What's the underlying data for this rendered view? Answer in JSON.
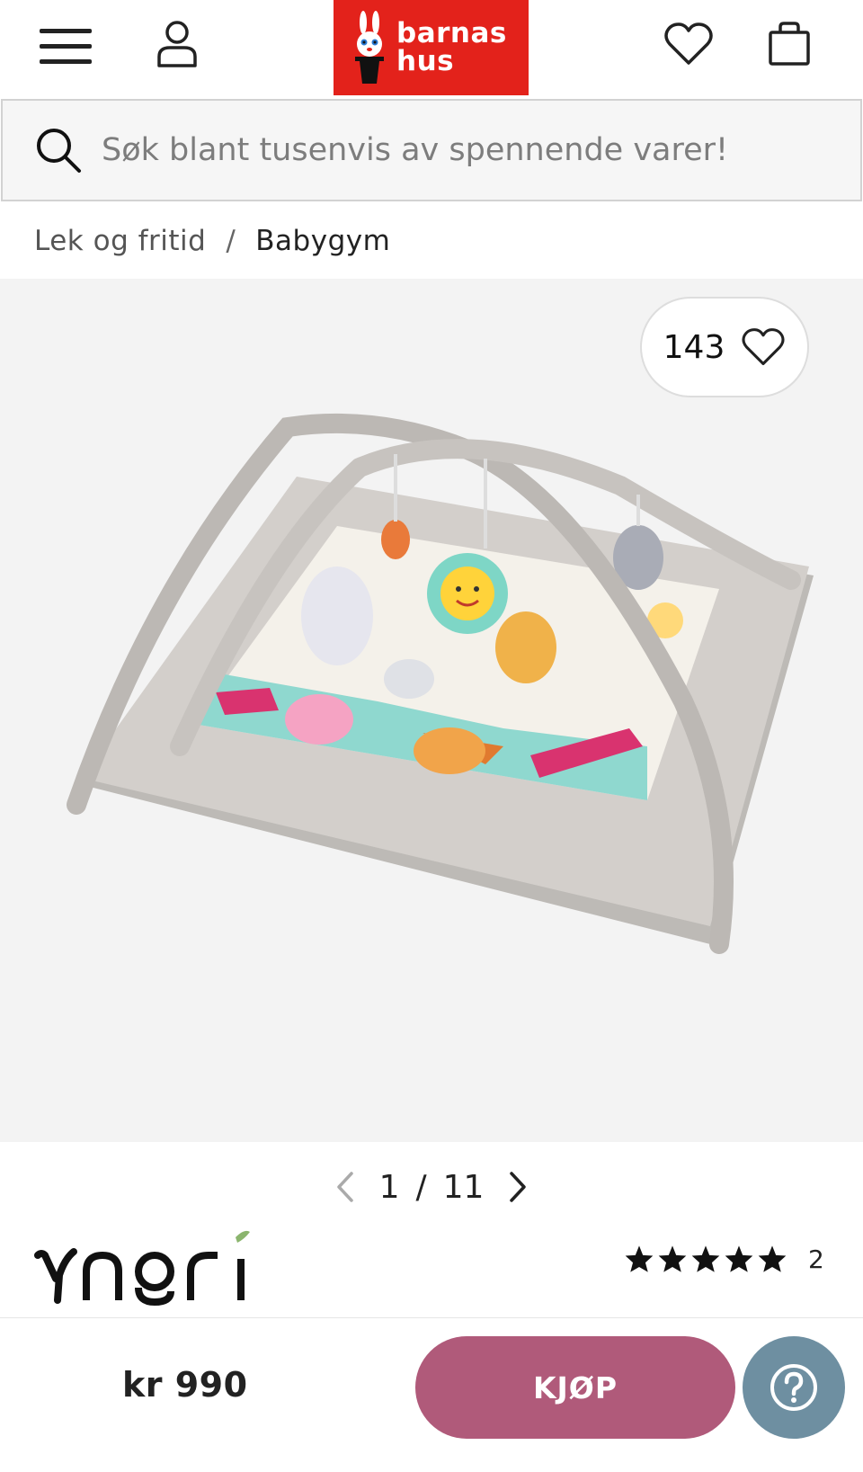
{
  "header": {
    "menu_icon": "hamburger-menu-icon",
    "account_icon": "user-account-icon",
    "wishlist_icon": "heart-icon",
    "cart_icon": "shopping-bag-icon",
    "logo": {
      "line1": "barnas",
      "line2": "hus",
      "color": "#e3221b"
    }
  },
  "search": {
    "placeholder": "Søk blant tusenvis av spennende varer!",
    "icon": "search-icon"
  },
  "breadcrumb": {
    "items": [
      {
        "label": "Lek og fritid"
      },
      {
        "label": "Babygym"
      }
    ],
    "separator": "/"
  },
  "gallery": {
    "favorite_count": "143",
    "favorite_icon": "heart-icon",
    "pager": {
      "current": "1",
      "separator": "/",
      "total": "11"
    }
  },
  "product": {
    "brand": "Yngri",
    "rating": {
      "stars": 5,
      "max": 5,
      "count": "2"
    }
  },
  "bottom_bar": {
    "price": "kr 990",
    "buy_label": "KJØP",
    "buy_color": "#b05a7a",
    "help_icon": "question-mark-icon",
    "help_color": "#6e8fa1"
  }
}
